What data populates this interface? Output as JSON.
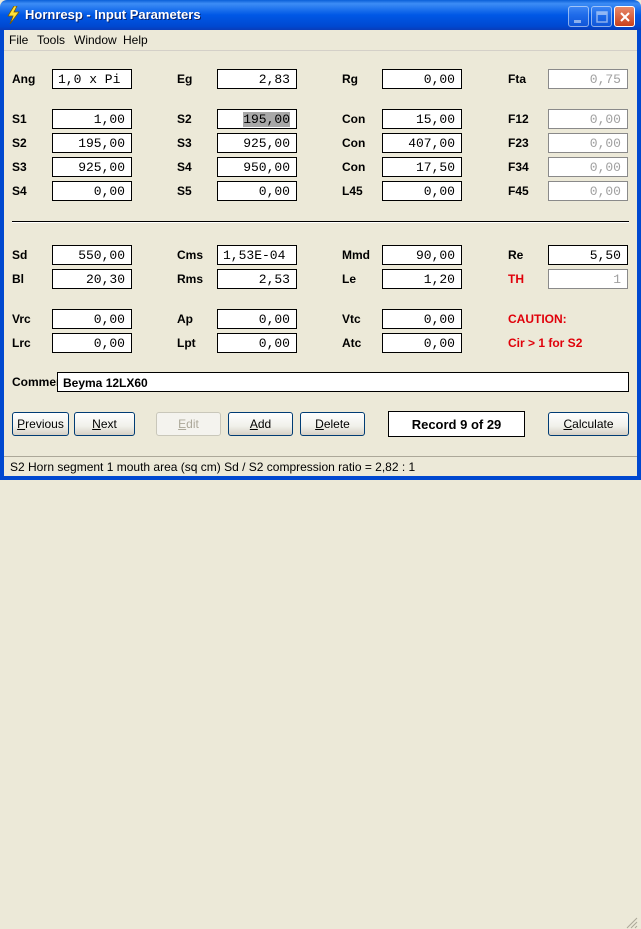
{
  "window": {
    "title": "Hornresp - Input Parameters"
  },
  "menu": [
    "File",
    "Tools",
    "Window",
    "Help"
  ],
  "rows": [
    {
      "cells": [
        {
          "label": "Ang",
          "value": "1,0 x Pi",
          "align": "left"
        },
        {
          "label": "Eg",
          "value": "2,83"
        },
        {
          "label": "Rg",
          "value": "0,00"
        },
        {
          "label": "Fta",
          "value": "0,75",
          "gray": true
        }
      ]
    },
    {
      "cells": [
        {
          "label": "S1",
          "value": "1,00"
        },
        {
          "label": "S2",
          "value": "195,00",
          "highlight": true
        },
        {
          "label": "Con",
          "value": "15,00"
        },
        {
          "label": "F12",
          "value": "0,00",
          "gray": true
        }
      ]
    },
    {
      "cells": [
        {
          "label": "S2",
          "value": "195,00"
        },
        {
          "label": "S3",
          "value": "925,00"
        },
        {
          "label": "Con",
          "value": "407,00"
        },
        {
          "label": "F23",
          "value": "0,00",
          "gray": true
        }
      ]
    },
    {
      "cells": [
        {
          "label": "S3",
          "value": "925,00"
        },
        {
          "label": "S4",
          "value": "950,00"
        },
        {
          "label": "Con",
          "value": "17,50"
        },
        {
          "label": "F34",
          "value": "0,00",
          "gray": true
        }
      ]
    },
    {
      "cells": [
        {
          "label": "S4",
          "value": "0,00"
        },
        {
          "label": "S5",
          "value": "0,00"
        },
        {
          "label": "L45",
          "value": "0,00"
        },
        {
          "label": "F45",
          "value": "0,00",
          "gray": true
        }
      ]
    },
    {
      "cells": [
        {
          "label": "Sd",
          "value": "550,00"
        },
        {
          "label": "Cms",
          "value": "1,53E-04",
          "align": "left"
        },
        {
          "label": "Mmd",
          "value": "90,00"
        },
        {
          "label": "Re",
          "value": "5,50"
        }
      ]
    },
    {
      "cells": [
        {
          "label": "Bl",
          "value": "20,30"
        },
        {
          "label": "Rms",
          "value": "2,53"
        },
        {
          "label": "Le",
          "value": "1,20"
        },
        {
          "label": "TH",
          "value": "1",
          "gray": true,
          "red_label": true
        }
      ]
    },
    {
      "cells": [
        {
          "label": "Vrc",
          "value": "0,00"
        },
        {
          "label": "Ap",
          "value": "0,00"
        },
        {
          "label": "Vtc",
          "value": "0,00"
        },
        {
          "label": "CAUTION:",
          "red_label": true,
          "no_field": true
        }
      ]
    },
    {
      "cells": [
        {
          "label": "Lrc",
          "value": "0,00"
        },
        {
          "label": "Lpt",
          "value": "0,00"
        },
        {
          "label": "Atc",
          "value": "0,00"
        },
        {
          "label": "Cir > 1 for S2",
          "red_label": true,
          "no_field": true
        }
      ]
    }
  ],
  "comment": {
    "label": "Comment",
    "value": "Beyma 12LX60"
  },
  "buttons": {
    "previous": {
      "label": "Previous",
      "underline": "P",
      "rest": "revious",
      "enabled": true
    },
    "next": {
      "label": "Next",
      "underline": "N",
      "rest": "ext",
      "enabled": true
    },
    "edit": {
      "label": "Edit",
      "underline": "E",
      "rest": "dit",
      "enabled": false
    },
    "add": {
      "label": "Add",
      "underline": "A",
      "rest": "dd",
      "enabled": true
    },
    "delete": {
      "label": "Delete",
      "underline": "D",
      "rest": "elete",
      "enabled": true
    },
    "calculate": {
      "label": "Calculate",
      "underline": "C",
      "rest": "alculate",
      "enabled": true
    }
  },
  "record": "Record 9 of 29",
  "status": "S2   Horn segment 1 mouth area  (sq cm)   Sd / S2 compression ratio = 2,82 : 1",
  "colors": {
    "title_bar": "#0058e6",
    "caution_red": "#e0000a",
    "face": "#ece9d8"
  },
  "icons": [
    "app-lightning-icon",
    "minimize-icon",
    "maximize-icon",
    "close-icon",
    "size-grip-icon"
  ]
}
